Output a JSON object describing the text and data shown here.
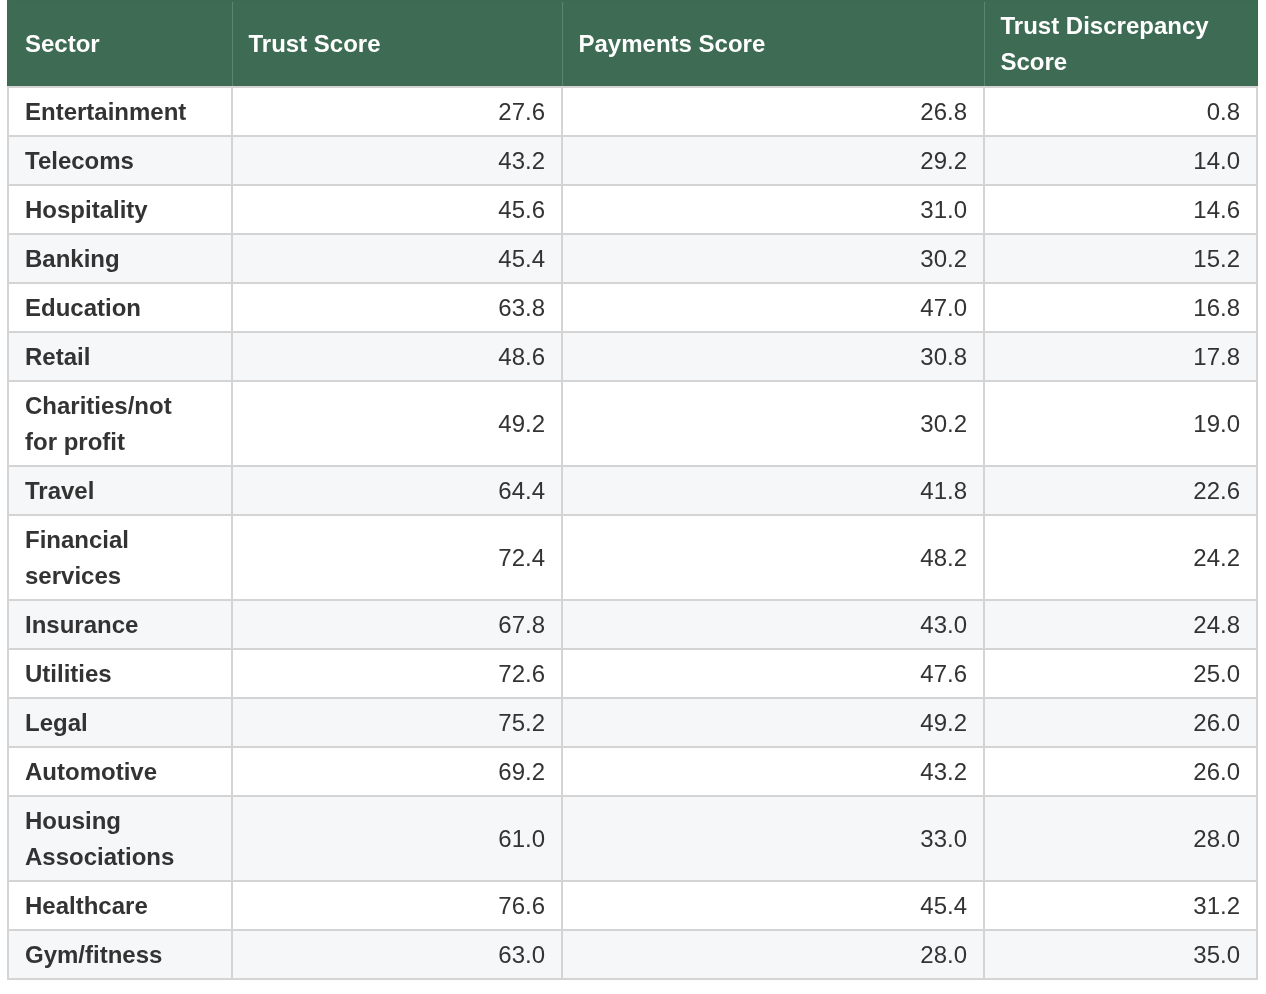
{
  "table": {
    "columns": [
      "Sector",
      "Trust Score",
      "Payments Score",
      "Trust Discrepancy Score"
    ],
    "rows": [
      [
        "Entertainment",
        "27.6",
        "26.8",
        "0.8"
      ],
      [
        "Telecoms",
        "43.2",
        "29.2",
        "14.0"
      ],
      [
        "Hospitality",
        "45.6",
        "31.0",
        "14.6"
      ],
      [
        "Banking",
        "45.4",
        "30.2",
        "15.2"
      ],
      [
        "Education",
        "63.8",
        "47.0",
        "16.8"
      ],
      [
        "Retail",
        "48.6",
        "30.8",
        "17.8"
      ],
      [
        "Charities/not for profit",
        "49.2",
        "30.2",
        "19.0"
      ],
      [
        "Travel",
        "64.4",
        "41.8",
        "22.6"
      ],
      [
        "Financial services",
        "72.4",
        "48.2",
        "24.2"
      ],
      [
        "Insurance",
        "67.8",
        "43.0",
        "24.8"
      ],
      [
        "Utilities",
        "72.6",
        "47.6",
        "25.0"
      ],
      [
        "Legal",
        "75.2",
        "49.2",
        "26.0"
      ],
      [
        "Automotive",
        "69.2",
        "43.2",
        "26.0"
      ],
      [
        "Housing Associations",
        "61.0",
        "33.0",
        "28.0"
      ],
      [
        "Healthcare",
        "76.6",
        "45.4",
        "31.2"
      ],
      [
        "Gym/fitness",
        "63.0",
        "28.0",
        "35.0"
      ]
    ]
  }
}
